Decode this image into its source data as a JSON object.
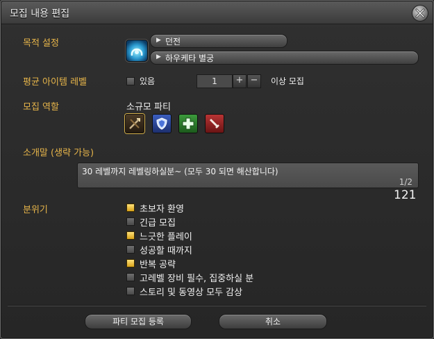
{
  "window": {
    "title": "모집 내용 편집"
  },
  "objective": {
    "label": "목적 설정",
    "category": "던전",
    "duty": "하우케타 별궁"
  },
  "ilvl": {
    "label": "평균 아이템 레벨",
    "checkbox_label": "있음",
    "checked": false,
    "value": "1",
    "plus": "+",
    "minus": "−",
    "suffix": "이상 모집"
  },
  "roles": {
    "label": "모집 역할",
    "party_type": "소규모 파티",
    "icons": [
      "all-roles-icon",
      "tank-icon",
      "healer-icon",
      "dps-icon"
    ]
  },
  "comment": {
    "label": "소개말 (생략 가능)",
    "text": "30 레벨까지 레벨링하실분~ (모두 30 되면 해산합니다)",
    "page": "1/2",
    "count": "121"
  },
  "mood": {
    "label": "분위기",
    "items": [
      {
        "label": "초보자 환영",
        "checked": true
      },
      {
        "label": "긴급 모집",
        "checked": false
      },
      {
        "label": "느긋한 플레이",
        "checked": true
      },
      {
        "label": "성공할 때까지",
        "checked": false
      },
      {
        "label": "반복 공략",
        "checked": true
      },
      {
        "label": "고레벨 장비 필수, 집중하실 분",
        "checked": false
      },
      {
        "label": "스토리 및 동영상 모두 감상",
        "checked": false
      }
    ]
  },
  "buttons": {
    "submit": "파티 모집 등록",
    "cancel": "취소"
  }
}
